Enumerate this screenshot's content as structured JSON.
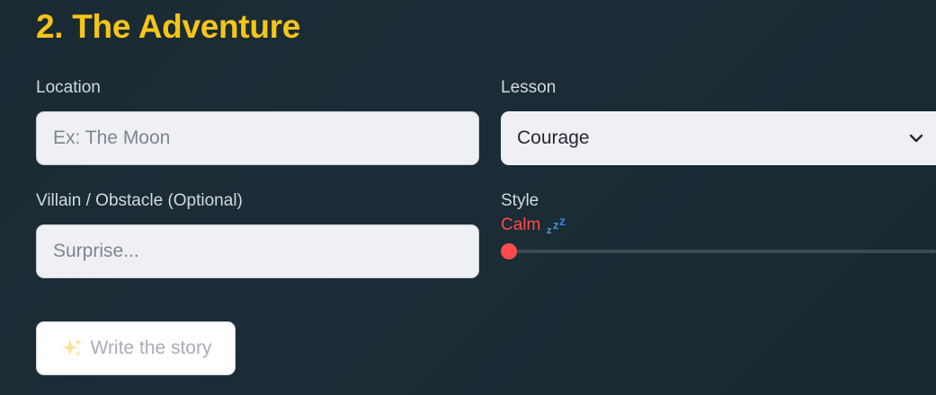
{
  "section": {
    "title": "2. The Adventure"
  },
  "location": {
    "label": "Location",
    "placeholder": "Ex: The Moon",
    "value": ""
  },
  "lesson": {
    "label": "Lesson",
    "selected": "Courage",
    "icon": "chevron-down-icon"
  },
  "villain": {
    "label": "Villain / Obstacle (Optional)",
    "placeholder": "Surprise...",
    "value": ""
  },
  "style": {
    "label": "Style",
    "value_text": "Calm",
    "value_icon": "zzz-icon",
    "slider_fraction": 0.0,
    "accent_color": "#ff4b4b"
  },
  "action": {
    "button_label": "Write the story",
    "button_icon": "sparkles-icon"
  },
  "colors": {
    "title": "#f5c518",
    "accent": "#ff4b4b",
    "background": "#1b2d36"
  }
}
